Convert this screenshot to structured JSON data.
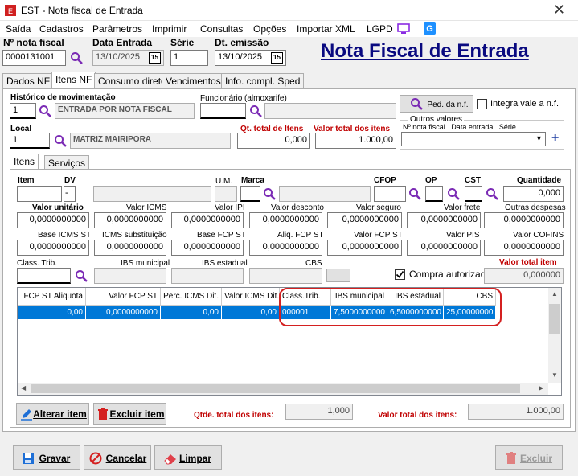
{
  "window": {
    "title": "EST - Nota fiscal de Entrada"
  },
  "menu": [
    "Saída",
    "Cadastros",
    "Parâmetros",
    "Imprimir",
    "Consultas",
    "Opções",
    "Importar XML",
    "LGPD"
  ],
  "header": {
    "nota_label": "Nº nota fiscal",
    "nota_value": "0000131001",
    "data_entrada_label": "Data Entrada",
    "data_entrada_value": "13/10/2025",
    "serie_label": "Série",
    "serie_value": "1",
    "dt_emissao_label": "Dt. emissão",
    "dt_emissao_value": "13/10/2025",
    "big_title": "Nota Fiscal de Entrada",
    "cal_icon": "15"
  },
  "tabs": [
    "Dados NF",
    "Itens NF",
    "Consumo direto",
    "Vencimentos",
    "Info. compl. Sped"
  ],
  "form": {
    "historico_label": "Histórico de movimentação",
    "historico_code": "1",
    "historico_desc": "ENTRADA POR NOTA FISCAL",
    "funcionario_label": "Funcionário (almoxarife)",
    "ped_button": "Ped. da n.f.",
    "integra_label": "Integra vale a n.f.",
    "local_label": "Local",
    "local_code": "1",
    "local_desc": "MATRIZ MAIRIPORA",
    "qt_total_label": "Qt. total de Itens",
    "qt_total_value": "0,000",
    "valor_total_label": "Valor total dos itens",
    "valor_total_value": "1.000,00",
    "outros_label": "Outros valores",
    "outros_cols": "Nº nota fiscal   Data entrada   Série",
    "plus": "+"
  },
  "subtabs": [
    "Itens",
    "Serviços"
  ],
  "items": {
    "row1": {
      "item": "Item",
      "dv": "DV",
      "um": "U.M.",
      "marca": "Marca",
      "cfop": "CFOP",
      "op": "OP",
      "cst": "CST",
      "quantidade": "Quantidade",
      "quantidade_value": "0,000",
      "dv_value": "-"
    },
    "row2_labels": [
      "Valor unitário",
      "Valor ICMS",
      "Valor IPI",
      "Valor desconto",
      "Valor seguro",
      "Valor frete",
      "Outras despesas"
    ],
    "row2_values": [
      "0,0000000000",
      "0,0000000000",
      "0,0000000000",
      "0,0000000000",
      "0,0000000000",
      "0,0000000000",
      "0,0000000000"
    ],
    "row3_labels": [
      "Base ICMS ST",
      "ICMS substituição",
      "Base FCP ST",
      "Aliq. FCP ST",
      "Valor FCP ST",
      "Valor PIS",
      "Valor COFINS"
    ],
    "row3_values": [
      "0,0000000000",
      "0,0000000000",
      "0,0000000000",
      "0,0000000000",
      "0,0000000000",
      "0,0000000000",
      "0,0000000000"
    ],
    "class_trib_label": "Class. Trib.",
    "ibs_mun_label": "IBS municipal",
    "ibs_est_label": "IBS estadual",
    "cbs_label": "CBS",
    "ellipsis": "...",
    "compra_label": "Compra autorizada",
    "valor_total_item_label": "Valor total item",
    "valor_total_item_value": "0,000000"
  },
  "grid": {
    "headers": [
      "FCP ST Aliquota",
      "Valor FCP ST",
      "Perc. ICMS Dit.",
      "Valor ICMS Dit.",
      "Class.Trib.",
      "IBS municipal",
      "IBS estadual",
      "CBS"
    ],
    "row": [
      "0,00",
      "0,0000000000",
      "0,00",
      "0,00",
      "000001",
      "7,5000000000",
      "6,5000000000",
      "25,00000000..."
    ]
  },
  "actions": {
    "alterar": "Alterar item",
    "excluir_item": "Excluir item",
    "qtde_label": "Qtde. total dos itens:",
    "qtde_value": "1,000",
    "valor_label": "Valor total dos itens:",
    "valor_value": "1.000,00"
  },
  "footer": {
    "gravar": "Gravar",
    "cancelar": "Cancelar",
    "limpar": "Limpar",
    "excluir": "Excluir"
  },
  "colors": {
    "accent": "#0078d7",
    "selection": "#0078d7",
    "required": "#c00000",
    "title": "#0a0a80"
  }
}
